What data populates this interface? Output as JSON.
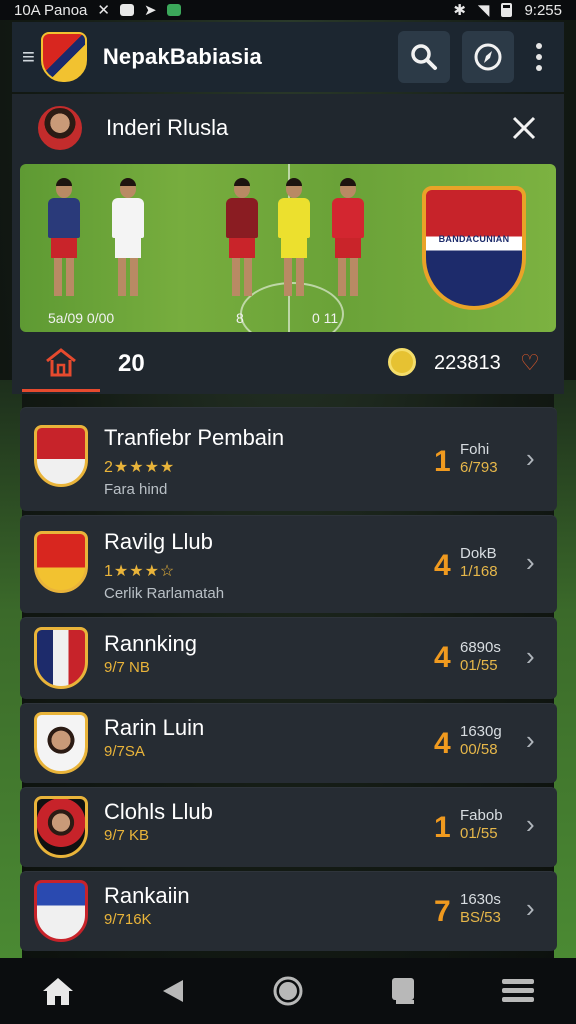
{
  "status_bar": {
    "left_text": "10A Panoa",
    "time": "9:255"
  },
  "header": {
    "title": "NepakBabiasia",
    "icons": [
      "menu-icon",
      "club-logo",
      "search-icon",
      "compass-icon",
      "more-vert-icon"
    ]
  },
  "profile": {
    "name": "Inderi Rlusla"
  },
  "banner": {
    "caption_left": "5a/09  0/00",
    "caption_center": "8",
    "caption_right": "0 11",
    "crest_text": "BANDACUNIAN"
  },
  "tabs": {
    "count": "20",
    "score": "223813"
  },
  "list": [
    {
      "title": "Tranfiebr Pembain",
      "rating": "2★★★★",
      "sub": "Fara hind",
      "rank": "1",
      "stat1": "Fohi",
      "stat2": "6/793"
    },
    {
      "title": "Ravilg Llub",
      "rating": "1★★★☆",
      "sub": "Cerlik Rarlamatah",
      "rank": "4",
      "stat1": "DokB",
      "stat2": "1/168"
    },
    {
      "title": "Rannking",
      "rating": "",
      "sub": "9/7 NB",
      "rank": "4",
      "stat1": "6890s",
      "stat2": "01/55"
    },
    {
      "title": "Rarin Luin",
      "rating": "",
      "sub": "9/7SA",
      "rank": "4",
      "stat1": "1630g",
      "stat2": "00/58"
    },
    {
      "title": "Clohls Llub",
      "rating": "",
      "sub": "9/7 KB",
      "rank": "1",
      "stat1": "Fabob",
      "stat2": "01/55"
    },
    {
      "title": "Rankaiin",
      "rating": "",
      "sub": "9/716K",
      "rank": "7",
      "stat1": "1630s",
      "stat2": "BS/53"
    }
  ],
  "nav": [
    "home-icon",
    "back-icon",
    "home-circle-icon",
    "recents-icon",
    "menu-icon"
  ],
  "colors": {
    "accent": "#f09a1f",
    "star": "#e9b43a",
    "tab_underline": "#e64a2e",
    "card_bg": "#262c33"
  }
}
